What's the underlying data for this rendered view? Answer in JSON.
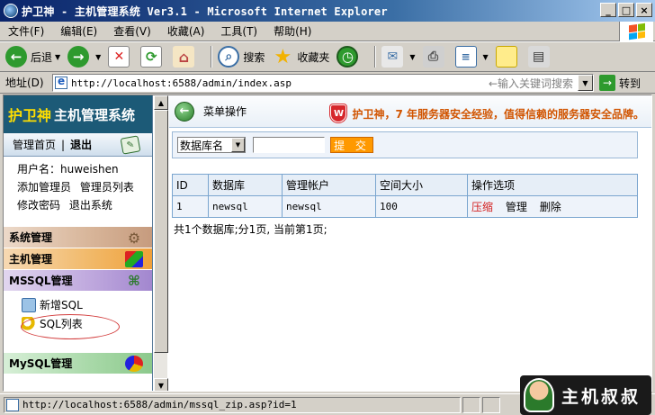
{
  "window": {
    "title": "护卫神 - 主机管理系统 Ver3.1 - Microsoft Internet Explorer"
  },
  "menu": [
    "文件(F)",
    "编辑(E)",
    "查看(V)",
    "收藏(A)",
    "工具(T)",
    "帮助(H)"
  ],
  "toolbar": {
    "back": "后退",
    "search": "搜索",
    "favorites": "收藏夹"
  },
  "address": {
    "label": "地址(D)",
    "url": "http://localhost:6588/admin/index.asp",
    "hint": "←输入关键词搜索",
    "go": "转到"
  },
  "sidebar": {
    "brand_a": "护卫神",
    "brand_b": "主机管理系统",
    "home": "管理首页",
    "sep": "|",
    "logout": "退出",
    "user_label": "用户名：",
    "username": "huweishen",
    "links": [
      "添加管理员",
      "管理员列表",
      "修改密码",
      "退出系统"
    ],
    "sections": [
      {
        "label": "系统管理"
      },
      {
        "label": "主机管理"
      },
      {
        "label": "MSSQL管理"
      }
    ],
    "mssql_items": [
      "新增SQL",
      "SQL列表"
    ],
    "mysql_label": "MySQL管理"
  },
  "main": {
    "menu_op": "菜单操作",
    "slogan": "护卫神，7 年服务器安全经验，值得信赖的服务器安全品牌。",
    "search": {
      "select_value": "数据库名",
      "submit": "提 交"
    },
    "table": {
      "headers": [
        "ID",
        "数据库",
        "管理帐户",
        "空间大小",
        "操作选项"
      ],
      "rows": [
        {
          "id": "1",
          "db": "newsql",
          "account": "newsql",
          "size": "100",
          "op_zip": "压缩",
          "op_manage": "管理",
          "op_delete": "删除"
        }
      ]
    },
    "pager": "共1个数据库;分1页, 当前第1页;"
  },
  "status": {
    "url": "http://localhost:6588/admin/mssql_zip.asp?id=1"
  },
  "watermark": {
    "text": "主机叔叔"
  },
  "colors": {
    "titlebar": "#0a246a",
    "brand": "#1c5a77",
    "submit": "#ff9900",
    "slogan": "#d15400"
  }
}
